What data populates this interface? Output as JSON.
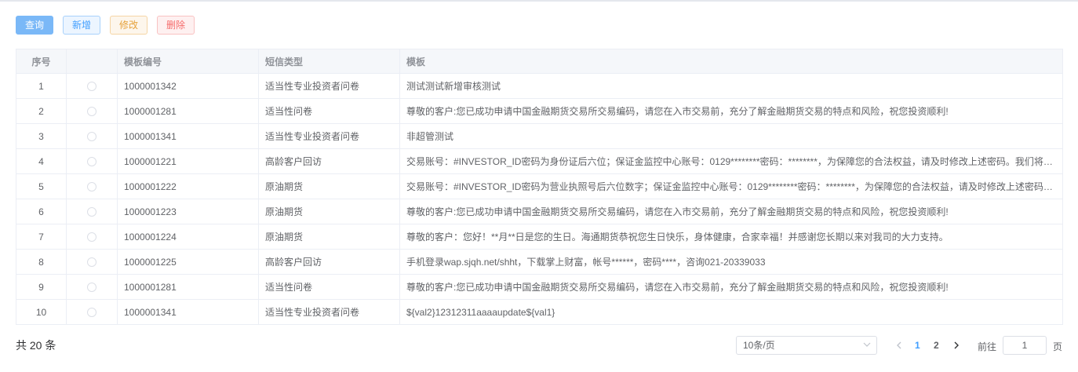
{
  "toolbar": {
    "query_label": "查询",
    "add_label": "新增",
    "edit_label": "修改",
    "delete_label": "删除"
  },
  "table": {
    "headers": [
      "序号",
      "",
      "模板编号",
      "短信类型",
      "模板"
    ],
    "rows": [
      {
        "idx": "1",
        "code": "1000001342",
        "type": "适当性专业投资者问卷",
        "template": "测试测试新增审核测试"
      },
      {
        "idx": "2",
        "code": "1000001281",
        "type": "适当性问卷",
        "template": "尊敬的客户:您已成功申请中国金融期货交易所交易编码，请您在入市交易前，充分了解金融期货交易的特点和风险，祝您投资顺利!"
      },
      {
        "idx": "3",
        "code": "1000001341",
        "type": "适当性专业投资者问卷",
        "template": "非超管测试"
      },
      {
        "idx": "4",
        "code": "1000001221",
        "type": "高龄客户回访",
        "template": "交易账号：#INVESTOR_ID密码为身份证后六位；保证金监控中心账号：0129********密码：********，为保障您的合法权益，请及时修改上述密码。我们将…"
      },
      {
        "idx": "5",
        "code": "1000001222",
        "type": "原油期货",
        "template": "交易账号：#INVESTOR_ID密码为营业执照号后六位数字；保证金监控中心账号：0129********密码：********，为保障您的合法权益，请及时修改上述密码…"
      },
      {
        "idx": "6",
        "code": "1000001223",
        "type": "原油期货",
        "template": "尊敬的客户:您已成功申请中国金融期货交易所交易编码，请您在入市交易前，充分了解金融期货交易的特点和风险，祝您投资顺利!"
      },
      {
        "idx": "7",
        "code": "1000001224",
        "type": "原油期货",
        "template": "尊敬的客户：您好！**月**日是您的生日。海通期货恭祝您生日快乐，身体健康，合家幸福！并感谢您长期以来对我司的大力支持。"
      },
      {
        "idx": "8",
        "code": "1000001225",
        "type": "高龄客户回访",
        "template": "手机登录wap.sjqh.net/shht，下载掌上财富，帐号******，密码****，咨询021-20339033"
      },
      {
        "idx": "9",
        "code": "1000001281",
        "type": "适当性问卷",
        "template": "尊敬的客户:您已成功申请中国金融期货交易所交易编码，请您在入市交易前，充分了解金融期货交易的特点和风险，祝您投资顺利!"
      },
      {
        "idx": "10",
        "code": "1000001341",
        "type": "适当性专业投资者问卷",
        "template": "${val2}12312311aaaaupdate${val1}"
      }
    ]
  },
  "pagination": {
    "total_text": "共 20 条",
    "page_size": "10条/页",
    "pages": [
      "1",
      "2"
    ],
    "current_page": "1",
    "goto_label": "前往",
    "goto_value": "1",
    "page_unit": "页"
  },
  "colors": {
    "primary": "#409eff",
    "warning": "#e6a23c",
    "danger": "#f56c6c"
  }
}
